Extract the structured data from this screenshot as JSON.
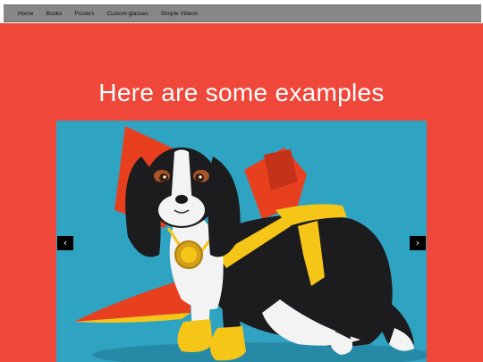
{
  "nav": {
    "items": [
      "Home",
      "Books",
      "Posters",
      "Custom glasses",
      "Simple Videos"
    ]
  },
  "hero": {
    "title": "Here are some examples"
  },
  "carousel": {
    "prev_label": "‹",
    "next_label": "›",
    "image_description_icon": "dog-in-cape-illustration"
  },
  "colors": {
    "page_bg": "#f0473b",
    "nav_bg": "#878787",
    "carousel_bg": "#2fa3c2",
    "cape_red": "#e8401f",
    "sash_yellow": "#f5c518"
  }
}
